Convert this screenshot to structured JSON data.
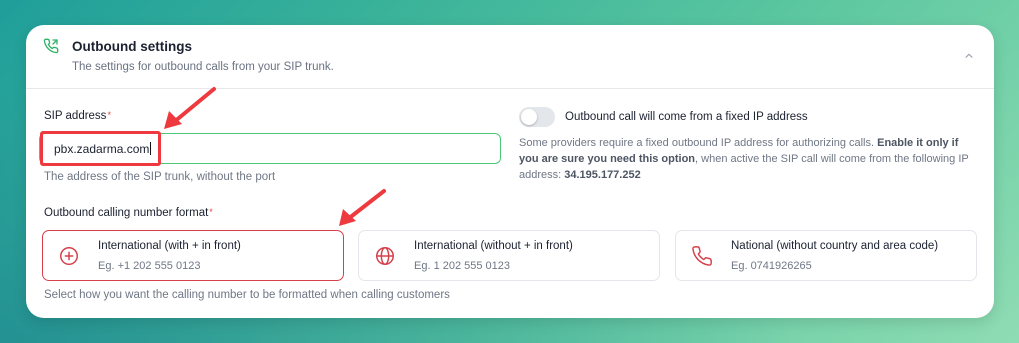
{
  "header": {
    "title": "Outbound settings",
    "subtitle": "The settings for outbound calls from your SIP trunk.",
    "icon": "phone-outgoing-icon"
  },
  "sip": {
    "label": "SIP address",
    "required_mark": "*",
    "value": "pbx.zadarma.com",
    "hint": "The address of the SIP trunk, without the port"
  },
  "fixed_ip": {
    "toggle_label": "Outbound call will come from a fixed IP address",
    "enabled": false,
    "desc_part1": "Some providers require a fixed outbound IP address for authorizing calls. ",
    "desc_bold1": "Enable it only if you are sure you need this option",
    "desc_part2": ", when active the SIP call will come from the following IP address: ",
    "desc_bold2": "34.195.177.252"
  },
  "format": {
    "label": "Outbound calling number format",
    "required_mark": "*",
    "hint": "Select how you want the calling number to be formatted when calling customers",
    "options": [
      {
        "title": "International (with + in front)",
        "example": "Eg. +1 202 555 0123",
        "icon": "plus-circle-icon",
        "selected": true
      },
      {
        "title": "International (without + in front)",
        "example": "Eg. 1 202 555 0123",
        "icon": "globe-icon",
        "selected": false
      },
      {
        "title": "National (without country and area code)",
        "example": "Eg. 0741926265",
        "icon": "phone-icon",
        "selected": false
      }
    ]
  },
  "colors": {
    "accent_green": "#4cc77a",
    "selected_red": "#d6404a",
    "annotation_red": "#ee3a3e"
  }
}
